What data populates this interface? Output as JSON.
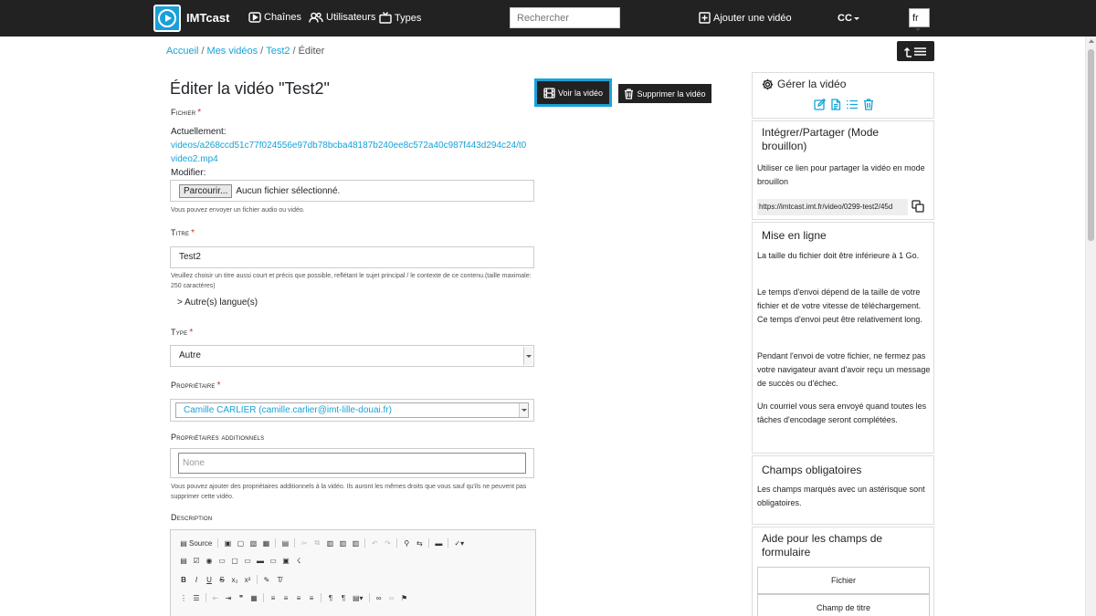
{
  "navbar": {
    "brand": "IMTcast",
    "nav_items": {
      "channels": "Chaînes",
      "users": "Utilisateurs",
      "types": "Types"
    },
    "search_placeholder": "Rechercher",
    "add_video": "Ajouter une vidéo",
    "user_initials": "CC",
    "language": "fr"
  },
  "breadcrumb": {
    "home": "Accueil",
    "my_videos": "Mes vidéos",
    "video": "Test2",
    "current": "Éditer"
  },
  "form": {
    "title": "Éditer la vidéo \"Test2\"",
    "view_button": "Voir la vidéo",
    "delete_button": "Supprimer la vidéo",
    "file": {
      "label": "Fichier",
      "current_label": "Actuellement:",
      "current_link": "videos/a268ccd51c77f024556e97db78bcba48187b240ee8c572a40c987f443d294c24/t0video2.mp4",
      "modify_label": "Modifier:",
      "browse_button": "Parcourir...",
      "no_file": "Aucun fichier sélectionné.",
      "help": "Vous pouvez envoyer un fichier audio ou vidéo."
    },
    "title_field": {
      "label": "Titre",
      "value": "Test2",
      "help": "Veuillez choisir un titre aussi court et précis que possible, reflétant le sujet principal / le contexte de ce contenu.(taille maximale: 250 caractères)",
      "other_languages": "> Autre(s) langue(s)"
    },
    "type_field": {
      "label": "Type",
      "value": "Autre"
    },
    "owner_field": {
      "label": "Propriétaire",
      "value": "Camille CARLIER (camille.carlier@imt-lille-douai.fr)"
    },
    "additional_owners": {
      "label": "Propriétaires additionnels",
      "placeholder": "None",
      "help": "Vous pouvez ajouter des propriétaires additionnels à la vidéo. Ils auront les mêmes droits que vous sauf qu'ils ne peuvent pas supprimer cette vidéo."
    },
    "description": {
      "label": "Description",
      "source_button": "Source"
    }
  },
  "sidebar": {
    "manage": {
      "title": "Gérer la vidéo"
    },
    "share": {
      "title": "Intégrer/Partager (Mode brouillon)",
      "text": "Utiliser ce lien pour partager la vidéo en mode brouillon",
      "url": "https://imtcast.imt.fr/video/0299-test2/45d"
    },
    "upload": {
      "title": "Mise en ligne",
      "p1": "La taille du fichier doit être inférieure à 1 Go.",
      "p2": "Le temps d'envoi dépend de la taille de votre fichier et de votre vitesse de téléchargement. Ce temps d'envoi peut être relativement long.",
      "p3": "Pendant l'envoi de votre fichier, ne fermez pas votre navigateur avant d'avoir reçu un message de succès ou d'échec.",
      "p4": "Un courriel vous sera envoyé quand toutes les tâches d'encodage seront complétées."
    },
    "mandatory": {
      "title": "Champs obligatoires",
      "text": "Les champs marqués avec un astérisque sont obligatoires."
    },
    "help": {
      "title": "Aide pour les champs de formulaire",
      "buttons": [
        "Fichier",
        "Champ de titre"
      ]
    }
  }
}
